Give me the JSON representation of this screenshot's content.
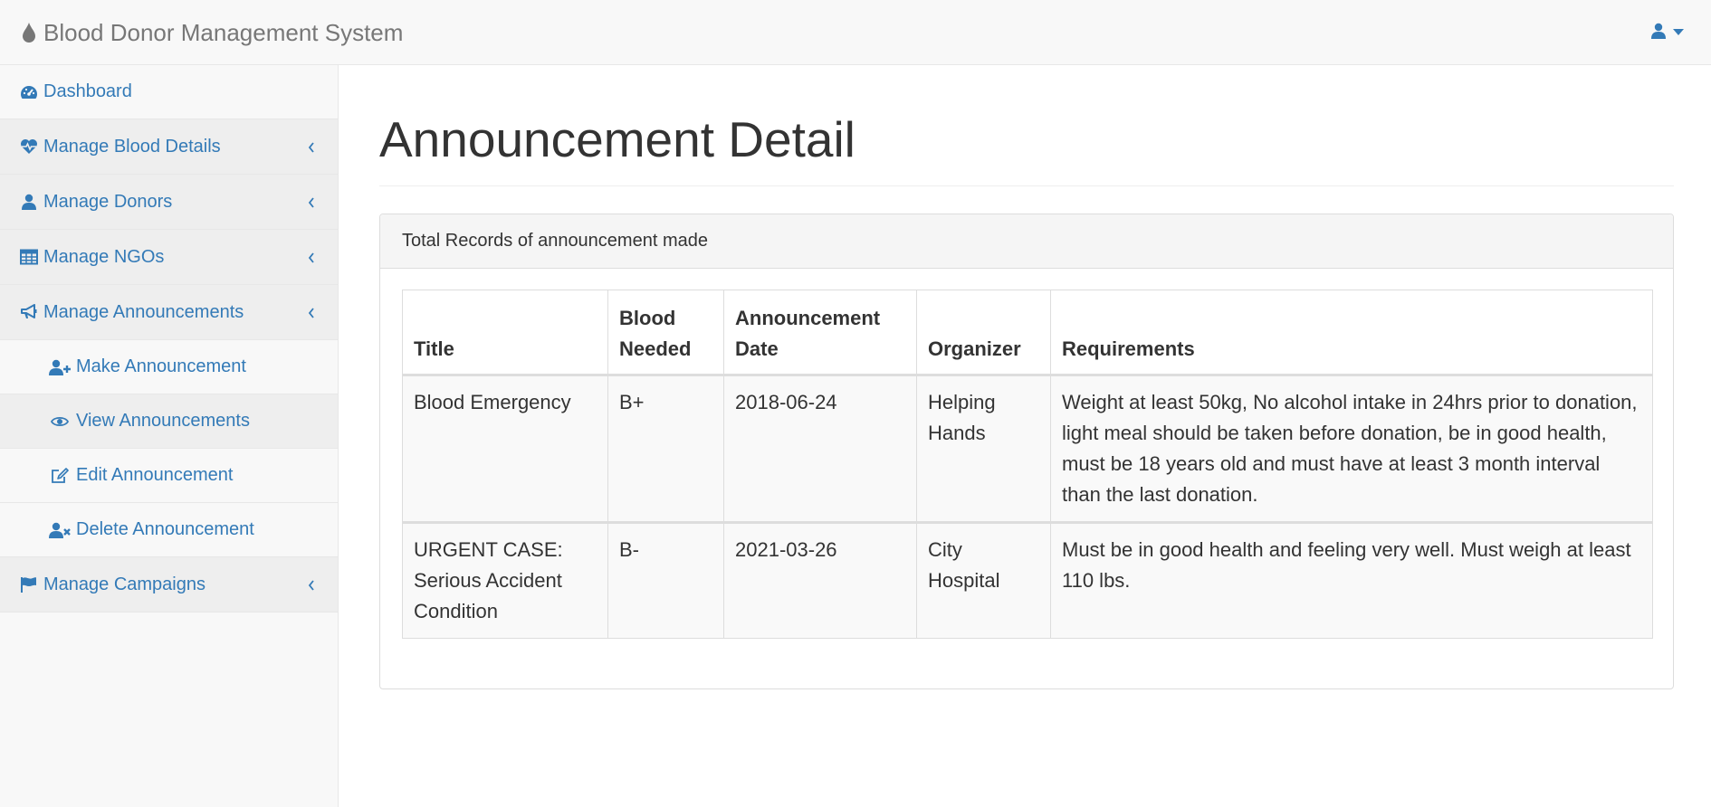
{
  "app": {
    "brand": "Blood Donor Management System"
  },
  "colors": {
    "link": "#337ab7",
    "brand_text": "#777777",
    "navbar_bg": "#f8f8f8"
  },
  "sidebar": {
    "dashboard": "Dashboard",
    "groups": [
      {
        "label": "Manage Blood Details",
        "icon": "heartbeat-icon"
      },
      {
        "label": "Manage Donors",
        "icon": "user-icon"
      },
      {
        "label": "Manage NGOs",
        "icon": "table-icon"
      },
      {
        "label": "Manage Announcements",
        "icon": "bullhorn-icon"
      }
    ],
    "announcement_items": [
      {
        "label": "Make Announcement",
        "icon": "user-plus-icon"
      },
      {
        "label": "View Announcements",
        "icon": "eye-icon"
      },
      {
        "label": "Edit Announcement",
        "icon": "edit-icon"
      },
      {
        "label": "Delete Announcement",
        "icon": "user-times-icon"
      }
    ],
    "campaigns": {
      "label": "Manage Campaigns",
      "icon": "flag-icon"
    }
  },
  "main": {
    "title": "Announcement Detail",
    "panel_heading": "Total Records of announcement made",
    "table": {
      "headers": {
        "title": "Title",
        "blood_needed": [
          "Blood",
          "Needed"
        ],
        "announcement_date": [
          "Announcement",
          "Date"
        ],
        "organizer": "Organizer",
        "requirements": "Requirements"
      },
      "rows": [
        {
          "title": "Blood Emergency",
          "blood": "B+",
          "date": "2018-06-24",
          "organizer": "Helping Hands",
          "requirements": "Weight at least 50kg, No alcohol intake in 24hrs prior to donation, light meal should be taken before donation, be in good health, must be 18 years old and must have at least 3 month interval than the last donation."
        },
        {
          "title": "URGENT CASE: Serious Accident Condition",
          "blood": "B-",
          "date": "2021-03-26",
          "organizer": "City Hospital",
          "requirements": "Must be in good health and feeling very well. Must weigh at least 110 lbs."
        }
      ]
    }
  }
}
